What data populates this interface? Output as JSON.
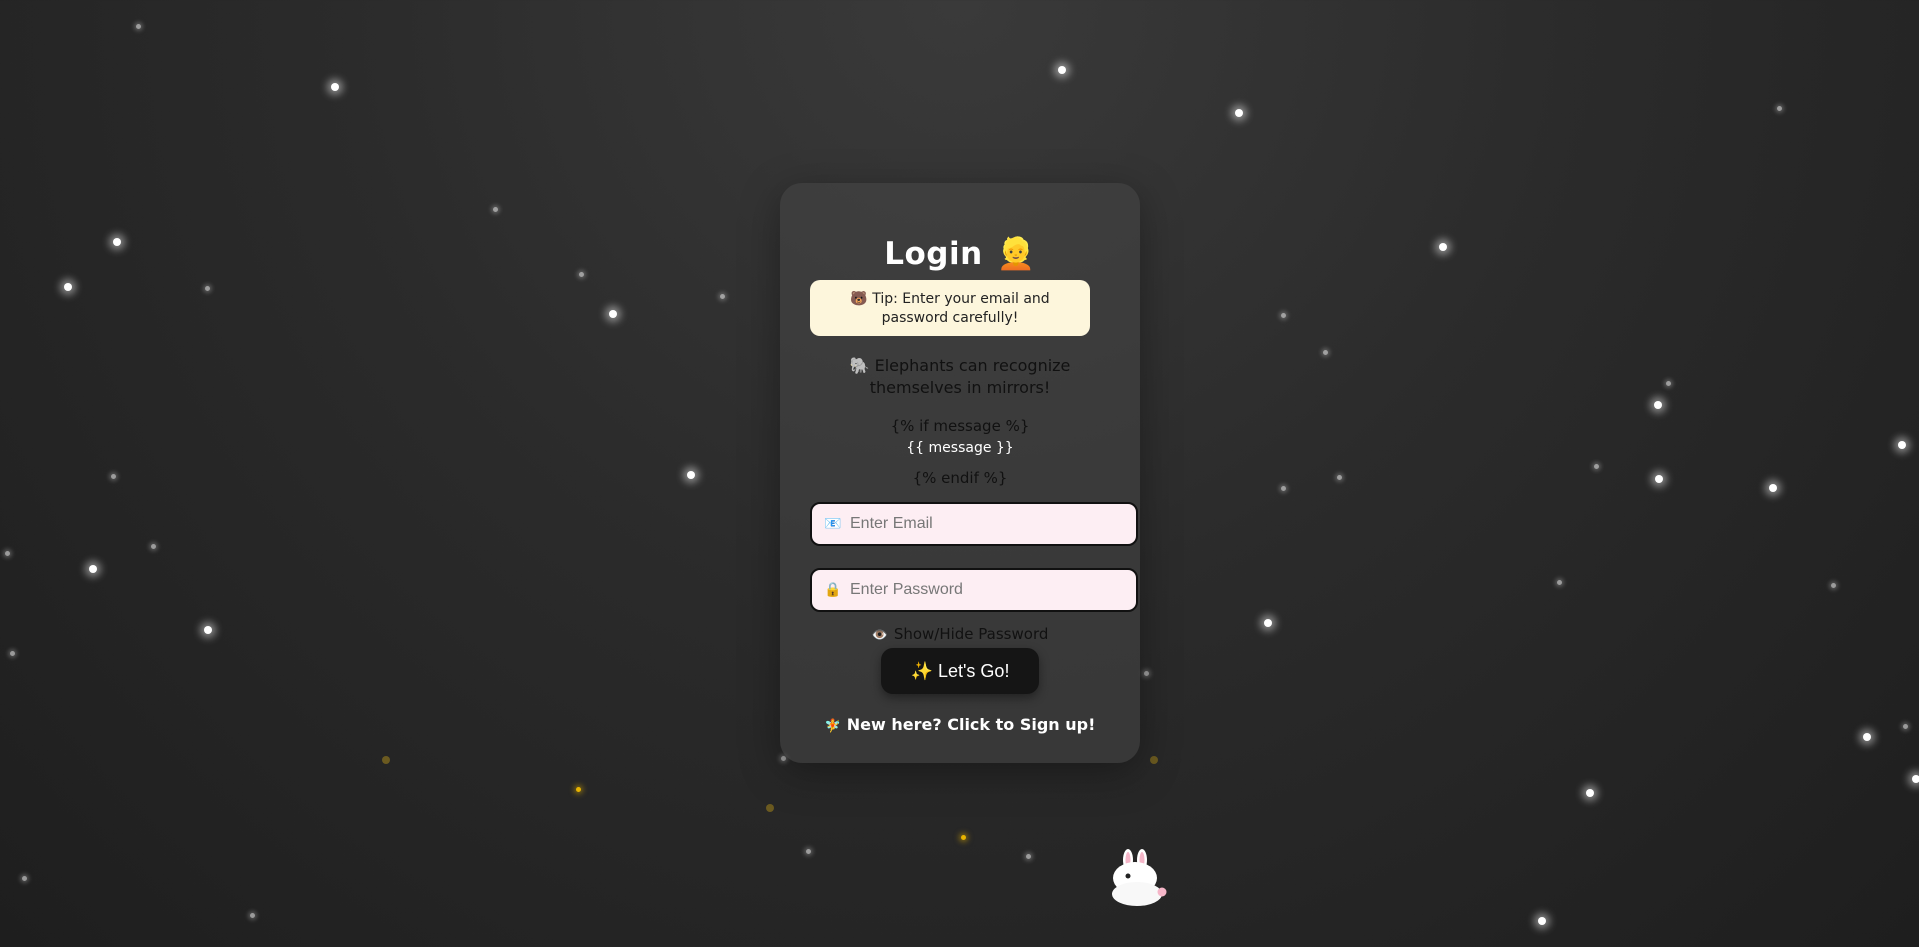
{
  "login": {
    "title": "Login",
    "title_emoji": "👱",
    "tip_icon": "🐻",
    "tip_text": "Tip: Enter your email and password carefully!",
    "fact_icon": "🐘",
    "fact_text": "Elephants can recognize themselves in mirrors!",
    "template_if": "{% if message %}",
    "template_message": "{{ message }}",
    "template_endif": "{% endif %}",
    "email_icon": "📧",
    "email_placeholder": "Enter Email",
    "password_icon": "🔒",
    "password_placeholder": "Enter Password",
    "toggle_icon": "👁️",
    "toggle_label": "Show/Hide Password",
    "submit_icon": "✨",
    "submit_label": "Let's Go!",
    "signup_icon": "🧚",
    "signup_label": "New here? Click to Sign up!"
  },
  "colors": {
    "tip_background": "#fdf6dc",
    "field_background": "#fdeef3",
    "button_background": "#151515",
    "spark": "#e8b400"
  }
}
